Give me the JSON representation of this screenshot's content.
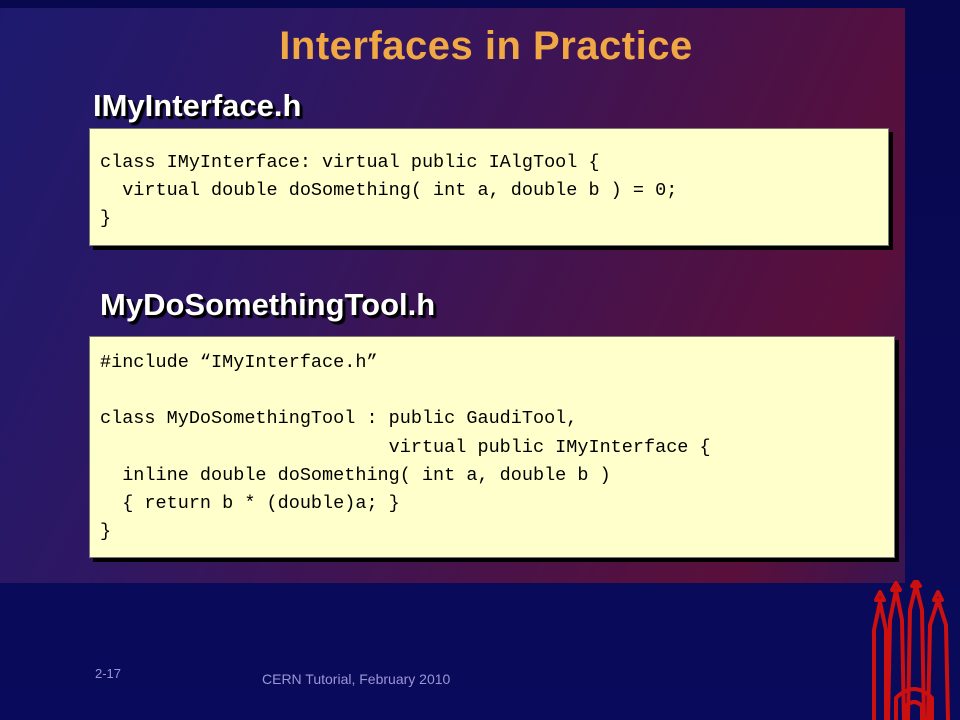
{
  "slide": {
    "title": "Interfaces in Practice",
    "section1": {
      "heading": "IMyInterface.h",
      "code": "class IMyInterface: virtual public IAlgTool {\n  virtual double doSomething( int a, double b ) = 0;\n}"
    },
    "section2": {
      "heading": "MyDoSomethingTool.h",
      "code": "#include “IMyInterface.h”\n\nclass MyDoSomethingTool : public GaudiTool,\n                          virtual public IMyInterface {\n  inline double doSomething( int a, double b )\n  { return b * (double)a; }\n}"
    },
    "footer": {
      "page_number": "2-17",
      "caption": "CERN Tutorial, February 2010"
    },
    "colors": {
      "title": "#f0a844",
      "code_background": "#ffffcc",
      "logo": "#cc1010"
    },
    "logo_icon": "cathedral-spires-icon"
  }
}
